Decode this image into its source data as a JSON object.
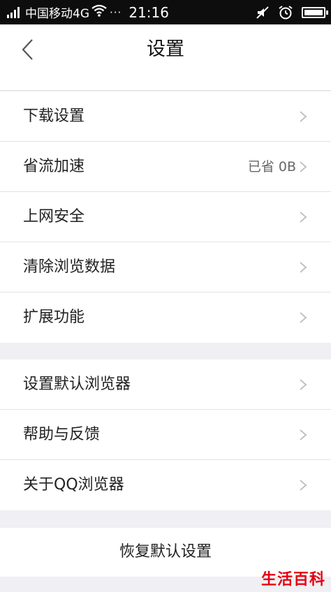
{
  "status_bar": {
    "carrier": "中国移动4G",
    "dots": "···",
    "time": "21:16",
    "battery_level": 1.0,
    "icons": [
      "signal-icon",
      "wifi-icon",
      "mute-icon",
      "alarm-icon",
      "battery-icon"
    ]
  },
  "nav": {
    "title": "设置",
    "back_icon": "chevron-left-icon"
  },
  "group1": [
    {
      "label": "下载设置",
      "value": ""
    },
    {
      "label": "省流加速",
      "value": "已省 0B"
    },
    {
      "label": "上网安全",
      "value": ""
    },
    {
      "label": "清除浏览数据",
      "value": ""
    },
    {
      "label": "扩展功能",
      "value": ""
    }
  ],
  "group2": [
    {
      "label": "设置默认浏览器"
    },
    {
      "label": "帮助与反馈"
    },
    {
      "label": "关于QQ浏览器"
    }
  ],
  "reset_label": "恢复默认设置",
  "watermark": "生活百科",
  "colors": {
    "background": "#efeff4",
    "status_bar": "#0d0d0d",
    "watermark": "#e60012"
  }
}
